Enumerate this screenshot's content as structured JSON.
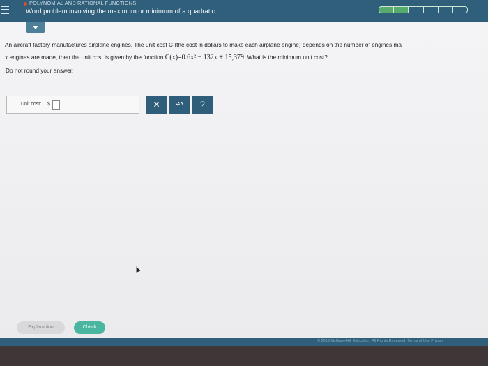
{
  "header": {
    "topic": "POLYNOMIAL AND RATIONAL FUNCTIONS",
    "title": "Word problem involving the maximum or minimum of a quadratic ...",
    "progress": {
      "segments": 6,
      "completed": 2
    }
  },
  "question": {
    "line1": "An aircraft factory manufactures airplane engines. The unit cost C (the cost in dollars to make each airplane engine) depends on the number of engines ma",
    "line2_prefix": "x engines are made, then the unit cost is given by the function",
    "formula": "C(x)=0.6x² − 132x + 15,379",
    "line2_suffix": ". What is the minimum unit cost?",
    "instruction": "Do not round your answer."
  },
  "answer": {
    "label": "Unit cost:",
    "currency": "$",
    "value": ""
  },
  "tools": {
    "clear": "✕",
    "undo": "↶",
    "help": "?"
  },
  "buttons": {
    "explanation": "Explanation",
    "check": "Check"
  },
  "footer": {
    "copyright": "© 2019 McGraw-Hill Education. All Rights Reserved.   Terms of Use   Privacy"
  },
  "colors": {
    "header": "#2f5f7a",
    "progress_done": "#57ab6d",
    "check": "#4bb6a0"
  }
}
